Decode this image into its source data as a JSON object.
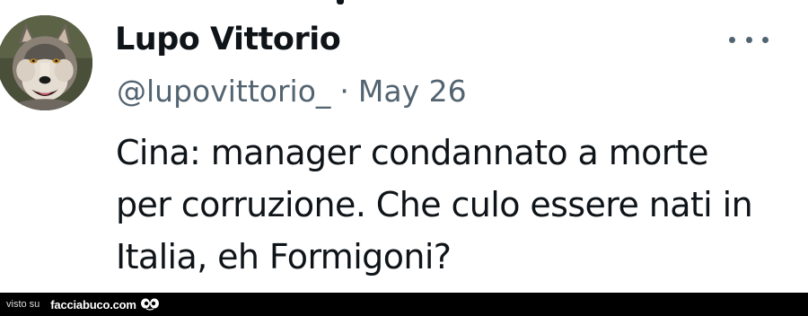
{
  "tweet": {
    "display_name": "Lupo Vittorio",
    "handle": "@lupovittorio_",
    "separator": "·",
    "date": "May 26",
    "text_lines": [
      "Cina: manager condannato a  morte",
      "per corruzione. Che culo essere nati in",
      "Italia, eh Formigoni?"
    ],
    "avatar_icon": "wolf-avatar",
    "more_icon": "more-options-icon"
  },
  "footer": {
    "visto_su": "visto su",
    "brand": "facciabuco.com",
    "brand_icon": "eyes-icon"
  },
  "colors": {
    "text_primary": "#0f1419",
    "text_secondary": "#536471",
    "footer_bg": "#000000"
  }
}
